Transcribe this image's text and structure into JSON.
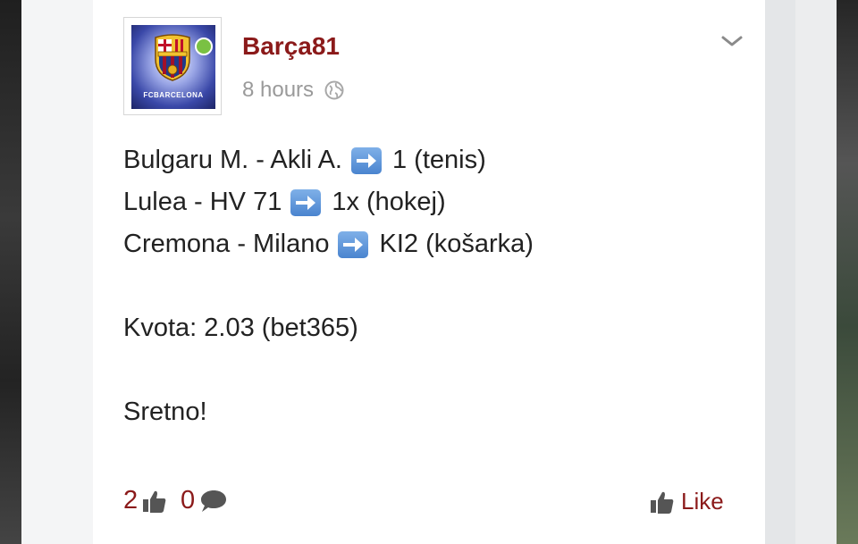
{
  "post": {
    "author": "Barça81",
    "time": "8 hours",
    "avatar_caption": "FCBARCELONA",
    "lines": [
      {
        "left": "Bulgaru M. - Akli A.",
        "right": "1 (tenis)"
      },
      {
        "left": "Lulea - HV 71",
        "right": "1x (hokej)"
      },
      {
        "left": "Cremona - Milano",
        "right": "KI2 (košarka)"
      }
    ],
    "odds": "Kvota: 2.03 (bet365)",
    "sign_off": "Sretno!"
  },
  "footer": {
    "likes_count": "2",
    "comments_count": "0",
    "like_label": "Like"
  },
  "colors": {
    "accent": "#8b1a1a",
    "online": "#7ac143",
    "muted": "#9a9a9a"
  },
  "icons": {
    "arrow": "right-arrow-icon",
    "thumbs_up": "thumbs-up-icon",
    "comment": "comment-bubble-icon",
    "globe": "globe-icon",
    "menu": "chevron-down-icon"
  }
}
